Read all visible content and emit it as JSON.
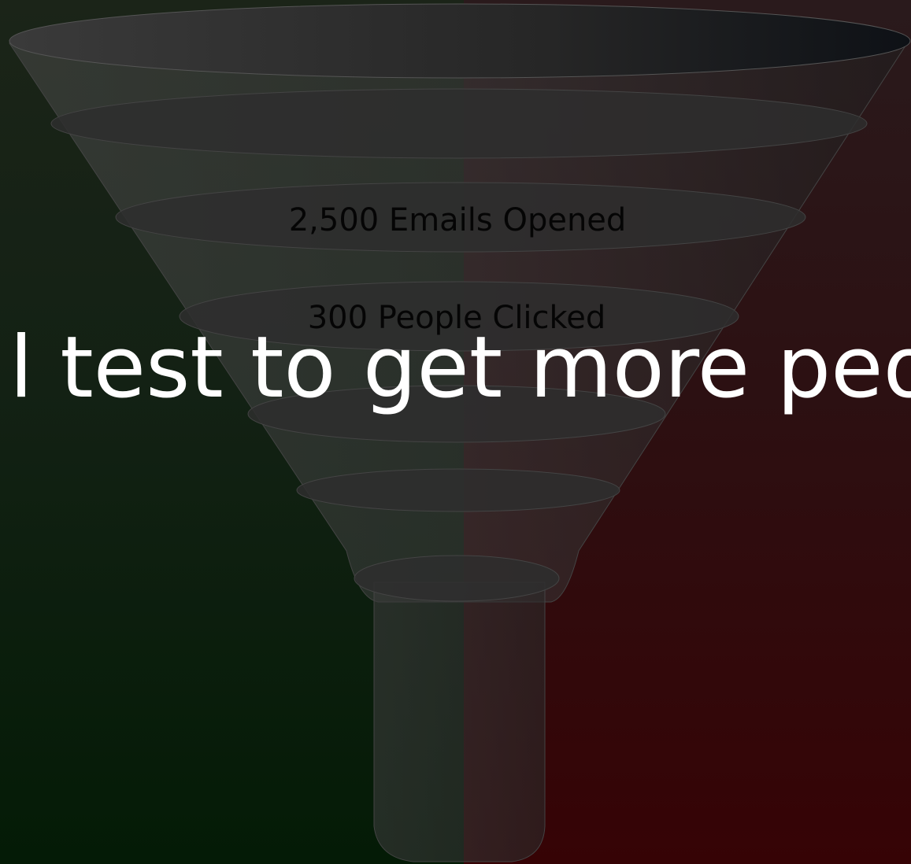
{
  "funnel": {
    "stage_labels": [
      "2,500 Emails Opened",
      "300 People Clicked"
    ]
  },
  "headline": {
    "text": "l test to get more peo"
  },
  "colors": {
    "left_panel": "#132114",
    "right_panel": "#2c1012",
    "funnel_body": "#3a3a3a",
    "label_text": "#050505",
    "headline_text": "#ffffff"
  }
}
